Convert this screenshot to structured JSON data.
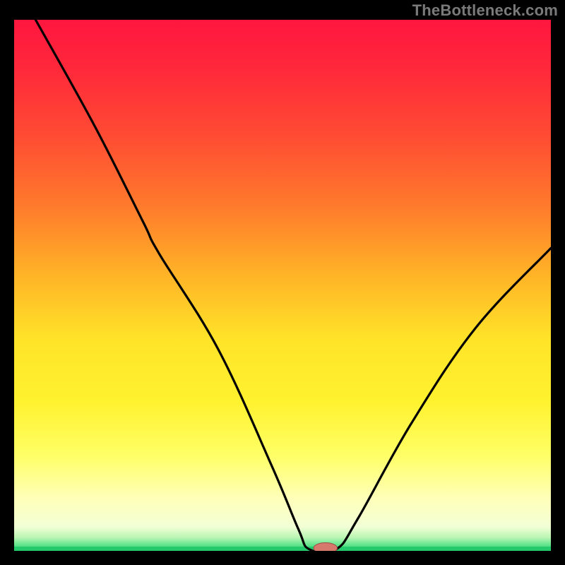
{
  "watermark": "TheBottleneck.com",
  "colors": {
    "frame": "#000000",
    "curve": "#000000",
    "baseline": "#23c96b",
    "marker_fill": "#d7786d",
    "marker_stroke": "#a04b45",
    "gradient_stops": [
      {
        "offset": 0.0,
        "color": "#ff163f"
      },
      {
        "offset": 0.1,
        "color": "#ff2a3a"
      },
      {
        "offset": 0.22,
        "color": "#ff4c33"
      },
      {
        "offset": 0.35,
        "color": "#ff7a2c"
      },
      {
        "offset": 0.48,
        "color": "#ffb327"
      },
      {
        "offset": 0.6,
        "color": "#ffe328"
      },
      {
        "offset": 0.72,
        "color": "#fff22f"
      },
      {
        "offset": 0.82,
        "color": "#ffff66"
      },
      {
        "offset": 0.9,
        "color": "#ffffb8"
      },
      {
        "offset": 0.955,
        "color": "#f2ffd6"
      },
      {
        "offset": 0.975,
        "color": "#b9f5b2"
      },
      {
        "offset": 0.988,
        "color": "#66e68f"
      },
      {
        "offset": 1.0,
        "color": "#23c96b"
      }
    ]
  },
  "chart_data": {
    "type": "line",
    "title": "",
    "xlabel": "",
    "ylabel": "",
    "ylim": [
      0,
      100
    ],
    "xlim": [
      0,
      100
    ],
    "baseline_y": 0,
    "marker": {
      "x": 58,
      "y": 0,
      "rx": 2.2,
      "ry": 1.0
    },
    "series": [
      {
        "name": "bottleneck-curve",
        "points": [
          {
            "x": 4,
            "y": 100
          },
          {
            "x": 15,
            "y": 80
          },
          {
            "x": 24,
            "y": 62
          },
          {
            "x": 27,
            "y": 56
          },
          {
            "x": 38,
            "y": 38
          },
          {
            "x": 48,
            "y": 16
          },
          {
            "x": 53,
            "y": 4
          },
          {
            "x": 55,
            "y": 0.3
          },
          {
            "x": 60,
            "y": 0.3
          },
          {
            "x": 64,
            "y": 6
          },
          {
            "x": 74,
            "y": 24
          },
          {
            "x": 86,
            "y": 42
          },
          {
            "x": 100,
            "y": 57
          }
        ]
      }
    ]
  }
}
